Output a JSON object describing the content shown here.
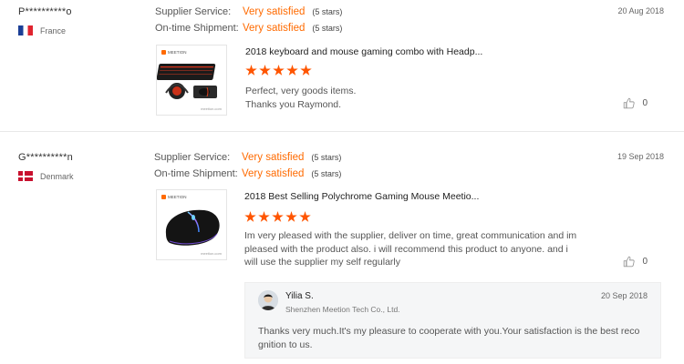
{
  "reviews": [
    {
      "buyer": "P**********o",
      "country": "France",
      "flag_icon": "france-flag-icon",
      "date": "20 Aug 2018",
      "supplier_service_label": "Supplier Service:",
      "supplier_service_value": "Very satisfied",
      "supplier_service_stars": "(5 stars)",
      "shipment_label": "On-time Shipment:",
      "shipment_value": "Very satisfied",
      "shipment_stars": "(5 stars)",
      "product_title": "2018 keyboard and mouse gaming combo with Headp...",
      "thumb_brand": "MEETION",
      "thumb_footer": "meetion.com",
      "rating": 5,
      "text_lines": [
        "Perfect, very goods items.",
        "Thanks you Raymond."
      ],
      "helpful_count": "0"
    },
    {
      "buyer": "G**********n",
      "country": "Denmark",
      "flag_icon": "denmark-flag-icon",
      "date": "19 Sep 2018",
      "supplier_service_label": "Supplier Service:",
      "supplier_service_value": "Very satisfied",
      "supplier_service_stars": "(5 stars)",
      "shipment_label": "On-time Shipment:",
      "shipment_value": "Very satisfied",
      "shipment_stars": "(5 stars)",
      "product_title": "2018 Best Selling Polychrome Gaming Mouse Meetio...",
      "thumb_brand": "MEETION",
      "thumb_footer": "meetion.com",
      "rating": 5,
      "text_lines": [
        "Im very pleased with the supplier, deliver on time, great communication and im",
        "pleased with the product also. i will recommend this product to anyone. and i",
        "will use the supplier my self regularly"
      ],
      "helpful_count": "0",
      "reply": {
        "name": "Yilia S.",
        "company": "Shenzhen Meetion Tech Co., Ltd.",
        "date": "20 Sep 2018",
        "text_lines": [
          "Thanks very much.It's my pleasure to cooperate with you.Your satisfaction is the best reco",
          "gnition to us."
        ]
      }
    }
  ],
  "colors": {
    "accent": "#ff6a00",
    "star": "#ff5500",
    "reply_bg": "#f5f6f7"
  }
}
